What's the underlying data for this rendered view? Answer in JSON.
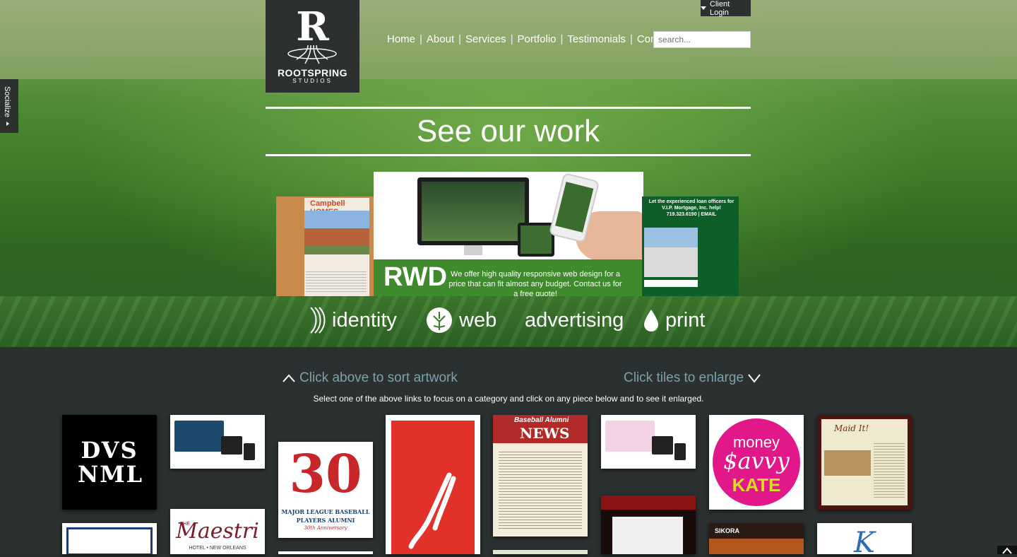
{
  "brand": {
    "logo_letter": "R",
    "name": "ROOTSPRING",
    "sub": "STUDIOS"
  },
  "header": {
    "nav": [
      "Home",
      "About",
      "Services",
      "Portfolio",
      "Testimonials",
      "Contact Us"
    ],
    "client_login": "Client Login",
    "search_placeholder": "search..."
  },
  "sidebar": {
    "socialize": "Socialize"
  },
  "hero": {
    "headline": "See our work",
    "carousel": {
      "left": {
        "brand": "Campbell HOMES"
      },
      "main": {
        "label": "RWD",
        "copy": "We offer high quality responsive web design for a price that can fit almost any budget. Contact us for a free quote!"
      },
      "right": {
        "text": "Let the experienced loan officers for V.I.P. Mortgage, Inc. help! 719.323.6190 | EMAIL"
      }
    }
  },
  "categories": [
    {
      "label": "identity",
      "icon": "identity-icon"
    },
    {
      "label": "web",
      "icon": "tree-icon"
    },
    {
      "label": "advertising",
      "icon": ""
    },
    {
      "label": "print",
      "icon": "drop-icon"
    }
  ],
  "gallery": {
    "hint_left": "Click above to sort artwork",
    "hint_right": "Click tiles to enlarge",
    "instructions": "Select one of the above links to focus on a category and click on any piece below and to see it enlarged.",
    "tiles": {
      "dvs": "DVS NML",
      "mlb_num": "30",
      "mlb_title": "MAJOR LEAGUE BASEBALL",
      "mlb_sub": "PLAYERS ALUMNI",
      "mlb_anniv": "30th Anniversary",
      "news_title": "NEWS",
      "news_head": "Baseball Alumni",
      "money_top": "money",
      "money_mid": "$avvy",
      "money_bot": "KATE",
      "maid_title": "Maid It!",
      "maestri_title": "Maestri",
      "maestri_the": "THE",
      "maestri_sub": "HOTEL • NEW ORLEANS",
      "sikora": "SIKORA",
      "k_letter": "K"
    }
  },
  "colors": {
    "accent_green": "#3f8a2c",
    "dark": "#2b3030",
    "hint": "#7ea1aa",
    "money_pink": "#e2178a",
    "money_yellow": "#d9e021"
  }
}
